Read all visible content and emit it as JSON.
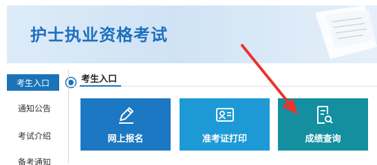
{
  "banner": {
    "title": "护士执业资格考试"
  },
  "sidebar": {
    "items": [
      {
        "label": "考生入口"
      },
      {
        "label": "通知公告"
      },
      {
        "label": "考试介绍"
      },
      {
        "label": "备考通知"
      }
    ]
  },
  "section": {
    "title": "考生入口"
  },
  "cards": [
    {
      "label": "网上报名",
      "icon": "pen-icon",
      "color": "#1c78c2"
    },
    {
      "label": "准考证打印",
      "icon": "id-card-icon",
      "color": "#1d9ad6"
    },
    {
      "label": "成绩查询",
      "icon": "search-document-icon",
      "color": "#138fa0"
    }
  ],
  "colors": {
    "accent": "#1a73b8",
    "annotation_arrow": "#e8342c"
  }
}
